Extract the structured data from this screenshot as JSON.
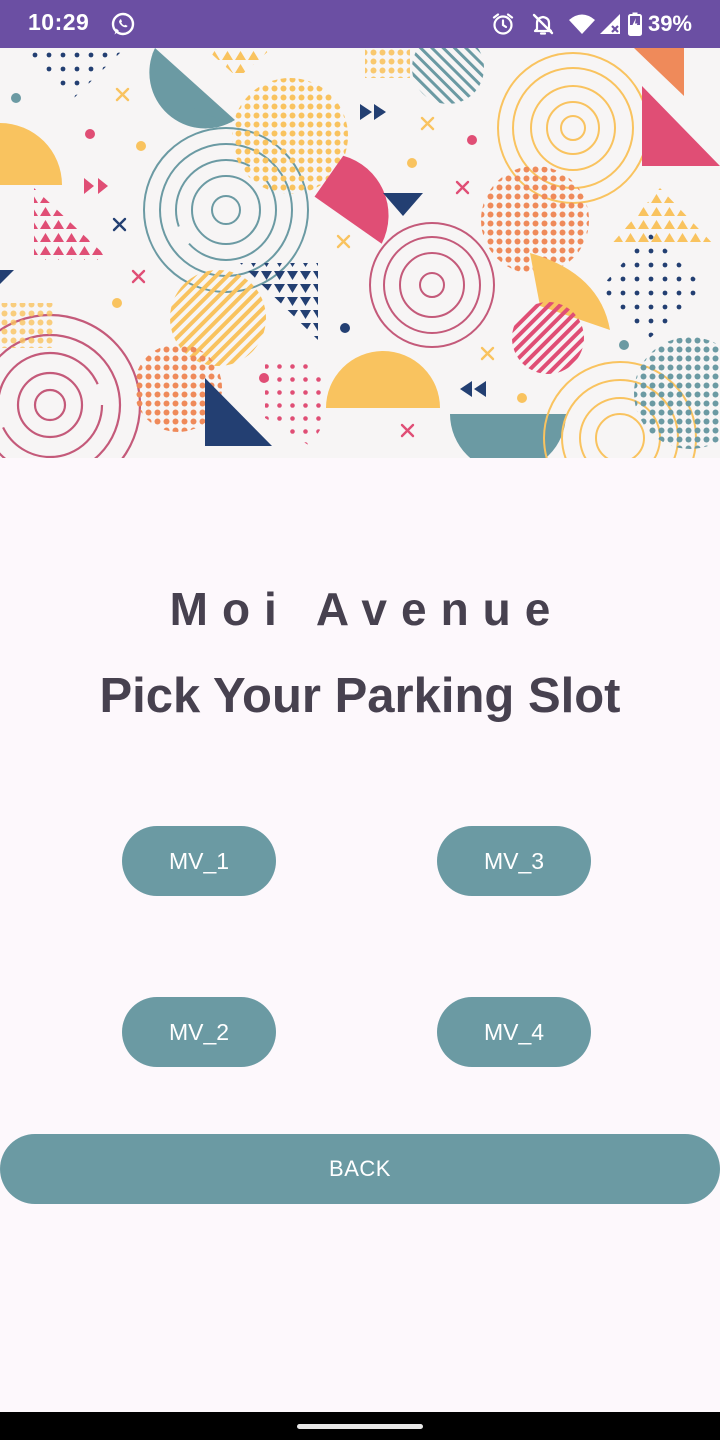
{
  "status_bar": {
    "time": "10:29",
    "battery": "39%",
    "icons": [
      "whatsapp-icon",
      "alarm-icon",
      "notifications-off-icon",
      "wifi-icon",
      "signal-icon",
      "battery-icon"
    ],
    "background": "#6b4fa3"
  },
  "banner": {
    "pattern": "geometric-memphis-pattern",
    "colors": [
      "#6b9aa3",
      "#f9c35f",
      "#e04e75",
      "#233f72",
      "#ef8a5a"
    ]
  },
  "header": {
    "location": "Moi Avenue",
    "title": "Pick Your Parking Slot"
  },
  "slots": [
    {
      "label": "MV_1"
    },
    {
      "label": "MV_3"
    },
    {
      "label": "MV_2"
    },
    {
      "label": "MV_4"
    }
  ],
  "actions": {
    "back_label": "BACK"
  },
  "theme": {
    "button_color": "#6b9aa3",
    "text_color": "#47414f",
    "background": "#fdf8fc"
  }
}
